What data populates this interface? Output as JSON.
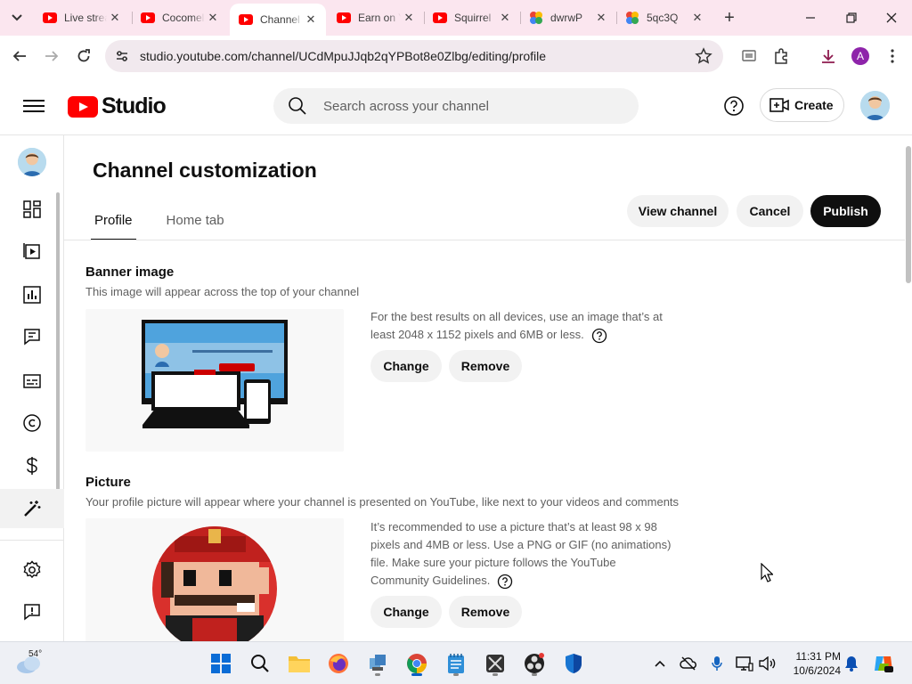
{
  "browser": {
    "tabs": [
      {
        "title": "Live stream",
        "favicon": "youtube-icon"
      },
      {
        "title": "Cocomelon",
        "favicon": "youtube-icon"
      },
      {
        "title": "Channel customization",
        "favicon": "youtube-icon",
        "active": true
      },
      {
        "title": "Earn on YouTube",
        "favicon": "youtube-icon"
      },
      {
        "title": "Squirrel",
        "favicon": "youtube-icon"
      },
      {
        "title": "dwrwP",
        "favicon": "photos-icon"
      },
      {
        "title": "5qc3Q",
        "favicon": "photos-icon"
      }
    ],
    "url": "studio.youtube.com/channel/UCdMpuJJqb2qYPBot8e0Zlbg/editing/profile",
    "profile_initial": "A"
  },
  "studio": {
    "logo_text": "Studio",
    "search_placeholder": "Search across your channel",
    "create_label": "Create"
  },
  "page": {
    "title": "Channel customization",
    "tabs": [
      {
        "label": "Profile",
        "active": true
      },
      {
        "label": "Home tab",
        "active": false
      }
    ],
    "actions": {
      "view_channel": "View channel",
      "cancel": "Cancel",
      "publish": "Publish"
    },
    "banner": {
      "title": "Banner image",
      "description": "This image will appear across the top of your channel",
      "info": "For the best results on all devices, use an image that’s at least 2048 x 1152 pixels and 6MB or less.",
      "change_label": "Change",
      "remove_label": "Remove"
    },
    "picture": {
      "title": "Picture",
      "description": "Your profile picture will appear where your channel is presented on YouTube, like next to your videos and comments",
      "info": "It’s recommended to use a picture that’s at least 98 x 98 pixels and 4MB or less. Use a PNG or GIF (no animations) file. Make sure your picture follows the YouTube Community Guidelines.",
      "change_label": "Change",
      "remove_label": "Remove"
    }
  },
  "leftnav": {
    "items": [
      {
        "name": "dashboard",
        "icon": "dashboard-icon"
      },
      {
        "name": "content",
        "icon": "content-icon"
      },
      {
        "name": "analytics",
        "icon": "analytics-icon"
      },
      {
        "name": "comments",
        "icon": "comments-icon"
      },
      {
        "name": "subtitles",
        "icon": "subtitles-icon"
      },
      {
        "name": "copyright",
        "icon": "copyright-icon"
      },
      {
        "name": "earn",
        "icon": "dollar-icon"
      },
      {
        "name": "customization",
        "icon": "magic-wand-icon",
        "selected": true
      },
      {
        "name": "settings",
        "icon": "gear-icon"
      },
      {
        "name": "send-feedback",
        "icon": "feedback-icon"
      }
    ]
  },
  "taskbar": {
    "weather_temp": "54°",
    "time": "11:31 PM",
    "date": "10/6/2024"
  },
  "colors": {
    "youtube_red": "#ff0000",
    "tabstrip": "#fbe6ef",
    "publish_bg": "#0f0f0f"
  }
}
